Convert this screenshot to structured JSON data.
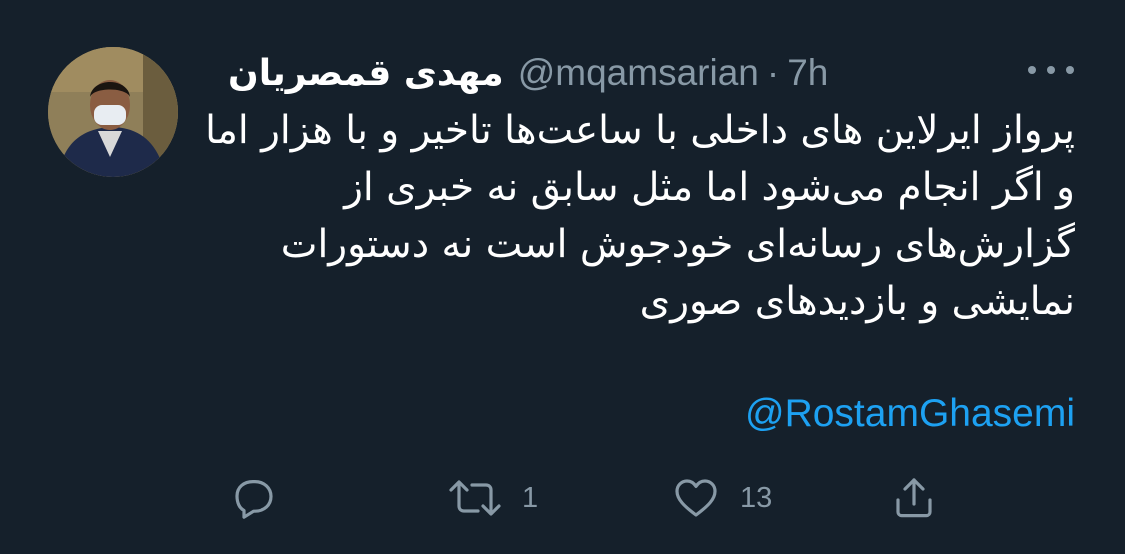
{
  "tweet": {
    "author_name": "مهدی قمصریان",
    "handle": "@mqamsarian",
    "separator": "·",
    "time": "7h",
    "text": "پرواز ایرلاین های داخلی با ساعت‌ها تاخیر و با هزار اما و اگر انجام می‌شود اما مثل سابق نه خبری از گزارش‌های رسانه‌ای خودجوش است نه دستورات نمایشی و بازدیدهای صوری",
    "mention": "@RostamGhasemi"
  },
  "actions": {
    "reply_icon": "reply-icon",
    "retweet_icon": "retweet-icon",
    "retweet_count": "1",
    "like_icon": "heart-icon",
    "like_count": "13",
    "share_icon": "share-icon"
  },
  "colors": {
    "background": "#15202b",
    "text": "#ffffff",
    "muted": "#8899a6",
    "link": "#1da1f2"
  }
}
